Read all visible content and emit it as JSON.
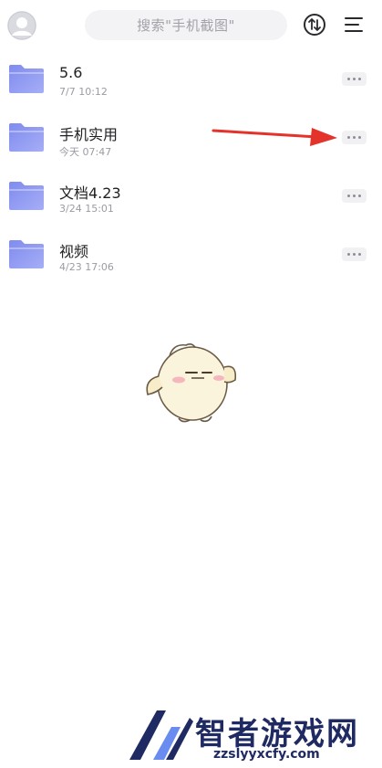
{
  "header": {
    "search_placeholder": "搜索\"手机截图\"",
    "avatar_icon": "user-avatar-icon",
    "sync_icon": "sort-sync-icon",
    "menu_icon": "menu-icon"
  },
  "folders": [
    {
      "name": "5.6",
      "date": "7/7 10:12"
    },
    {
      "name": "手机实用",
      "date": "今天 07:47"
    },
    {
      "name": "文档4.23",
      "date": "3/24 15:01"
    },
    {
      "name": "视频",
      "date": "4/23 17:06"
    }
  ],
  "colors": {
    "folder": "#8a94f0",
    "arrow": "#e3332a",
    "watermark": "#1f2a63"
  },
  "watermark": {
    "title": "智者游戏网",
    "url": "zzslyyxcfy.com"
  }
}
